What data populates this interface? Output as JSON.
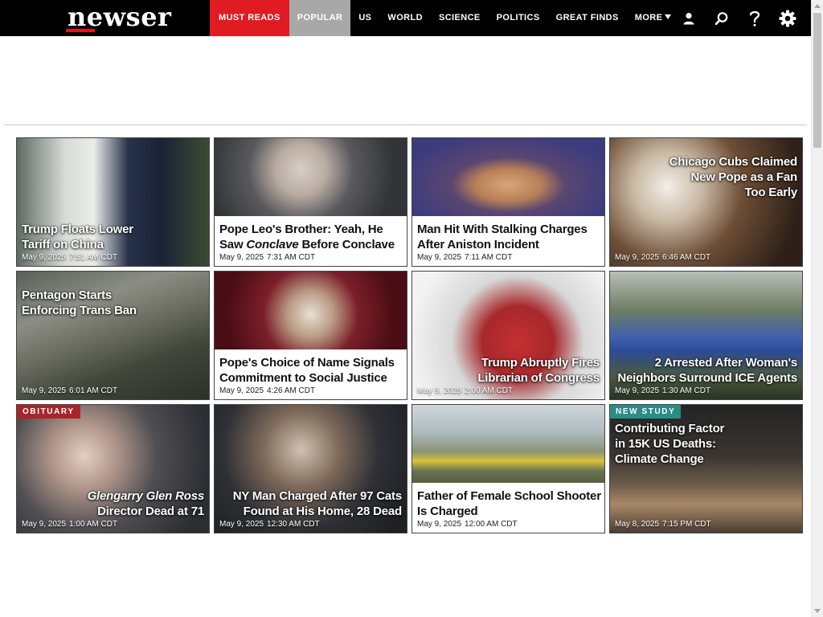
{
  "site": {
    "logo": "newser"
  },
  "nav": {
    "items": [
      "Must Reads",
      "Popular",
      "US",
      "World",
      "Science",
      "Politics",
      "Great Finds",
      "More"
    ]
  },
  "tools": [
    "account-icon",
    "search-icon",
    "help-icon",
    "settings-icon"
  ],
  "colors": {
    "brand_red": "#e11b22",
    "popular_gray": "#a8a8a8",
    "obituary_tag": "#a8262a",
    "study_tag": "#2a8c86"
  },
  "stories": [
    {
      "headline": "Trump Floats Lower Tariff on China",
      "date": "May 9, 2025",
      "time": "7:51 AM CDT"
    },
    {
      "headline_pre": "Pope Leo's Brother: Yeah, He Saw ",
      "headline_em": "Conclave",
      "headline_post": " Before Conclave",
      "date": "May 9, 2025",
      "time": "7:31 AM CDT"
    },
    {
      "headline": "Man Hit With Stalking Charges After Aniston Incident",
      "date": "May 9, 2025",
      "time": "7:11 AM CDT"
    },
    {
      "headline": "Chicago Cubs Claimed New Pope as a Fan Too Early",
      "date": "May 9, 2025",
      "time": "6:46 AM CDT"
    },
    {
      "headline": "Pentagon Starts Enforcing Trans Ban",
      "date": "May 9, 2025",
      "time": "6:01 AM CDT"
    },
    {
      "headline": "Pope's Choice of Name Signals Commitment to Social Justice",
      "date": "May 9, 2025",
      "time": "4:26 AM CDT"
    },
    {
      "headline": "Trump Abruptly Fires Librarian of Congress",
      "date": "May 9, 2025",
      "time": "2:00 AM CDT"
    },
    {
      "headline": "2 Arrested After Woman's Neighbors Surround ICE Agents",
      "date": "May 9, 2025",
      "time": "1:30 AM CDT"
    },
    {
      "tag": "OBITUARY",
      "headline_em": "Glengarry Glen Ross",
      "headline_post": "Director Dead at 71",
      "date": "May 9, 2025",
      "time": "1:00 AM CDT"
    },
    {
      "headline": "NY Man Charged After 97 Cats Found at His Home, 28 Dead",
      "date": "May 9, 2025",
      "time": "12:30 AM CDT"
    },
    {
      "headline": "Father of Female School Shooter Is Charged",
      "date": "May 9, 2025",
      "time": "12:00 AM CDT"
    },
    {
      "tag": "NEW STUDY",
      "headline": "Contributing Factor in 15K US Deaths: Climate Change",
      "date": "May 8, 2025",
      "time": "7:15 PM CDT"
    }
  ]
}
